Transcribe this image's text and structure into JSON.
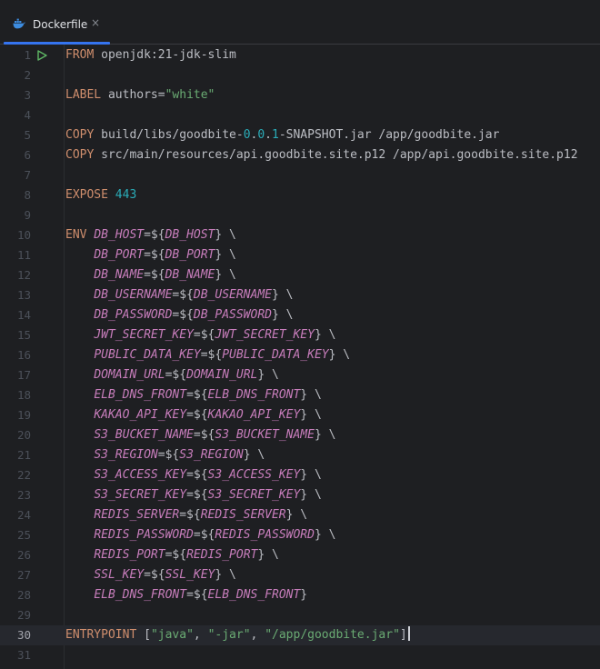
{
  "tab": {
    "label": "Dockerfile",
    "close": "×"
  },
  "colors": {
    "keyword": "#cf8e6d",
    "string": "#6aab73",
    "number": "#2aacb8",
    "variable": "#c77dbb",
    "text": "#bcbec4",
    "accent": "#3574f0"
  },
  "gutter": {
    "run_icon": "run-gutter-icon",
    "current_line": 30
  },
  "lines": [
    {
      "n": 1,
      "tokens": [
        {
          "t": "FROM",
          "c": "kw"
        },
        {
          "t": " openjdk:21-jdk-slim"
        }
      ]
    },
    {
      "n": 2,
      "tokens": []
    },
    {
      "n": 3,
      "tokens": [
        {
          "t": "LABEL",
          "c": "kw"
        },
        {
          "t": " authors="
        },
        {
          "t": "\"white\"",
          "c": "str"
        }
      ]
    },
    {
      "n": 4,
      "tokens": []
    },
    {
      "n": 5,
      "tokens": [
        {
          "t": "COPY",
          "c": "kw"
        },
        {
          "t": " build/libs/goodbite-"
        },
        {
          "t": "0",
          "c": "num"
        },
        {
          "t": "."
        },
        {
          "t": "0",
          "c": "num"
        },
        {
          "t": "."
        },
        {
          "t": "1",
          "c": "num"
        },
        {
          "t": "-SNAPSHOT.jar /app/goodbite.jar"
        }
      ]
    },
    {
      "n": 6,
      "tokens": [
        {
          "t": "COPY",
          "c": "kw"
        },
        {
          "t": " src/main/resources/api.goodbite.site.p12 /app/api.goodbite.site.p12"
        }
      ]
    },
    {
      "n": 7,
      "tokens": []
    },
    {
      "n": 8,
      "tokens": [
        {
          "t": "EXPOSE",
          "c": "kw"
        },
        {
          "t": " "
        },
        {
          "t": "443",
          "c": "num"
        }
      ]
    },
    {
      "n": 9,
      "tokens": []
    },
    {
      "n": 10,
      "tokens": [
        {
          "t": "ENV",
          "c": "kw"
        },
        {
          "t": " "
        },
        {
          "t": "DB_HOST",
          "c": "var"
        },
        {
          "t": "=${"
        },
        {
          "t": "DB_HOST",
          "c": "var"
        },
        {
          "t": "} \\"
        }
      ]
    },
    {
      "n": 11,
      "tokens": [
        {
          "t": "    "
        },
        {
          "t": "DB_PORT",
          "c": "var"
        },
        {
          "t": "=${"
        },
        {
          "t": "DB_PORT",
          "c": "var"
        },
        {
          "t": "} \\"
        }
      ]
    },
    {
      "n": 12,
      "tokens": [
        {
          "t": "    "
        },
        {
          "t": "DB_NAME",
          "c": "var"
        },
        {
          "t": "=${"
        },
        {
          "t": "DB_NAME",
          "c": "var"
        },
        {
          "t": "} \\"
        }
      ]
    },
    {
      "n": 13,
      "tokens": [
        {
          "t": "    "
        },
        {
          "t": "DB_USERNAME",
          "c": "var"
        },
        {
          "t": "=${"
        },
        {
          "t": "DB_USERNAME",
          "c": "var"
        },
        {
          "t": "} \\"
        }
      ]
    },
    {
      "n": 14,
      "tokens": [
        {
          "t": "    "
        },
        {
          "t": "DB_PASSWORD",
          "c": "var"
        },
        {
          "t": "=${"
        },
        {
          "t": "DB_PASSWORD",
          "c": "var"
        },
        {
          "t": "} \\"
        }
      ]
    },
    {
      "n": 15,
      "tokens": [
        {
          "t": "    "
        },
        {
          "t": "JWT_SECRET_KEY",
          "c": "var"
        },
        {
          "t": "=${"
        },
        {
          "t": "JWT_SECRET_KEY",
          "c": "var"
        },
        {
          "t": "} \\"
        }
      ]
    },
    {
      "n": 16,
      "tokens": [
        {
          "t": "    "
        },
        {
          "t": "PUBLIC_DATA_KEY",
          "c": "var"
        },
        {
          "t": "=${"
        },
        {
          "t": "PUBLIC_DATA_KEY",
          "c": "var"
        },
        {
          "t": "} \\"
        }
      ]
    },
    {
      "n": 17,
      "tokens": [
        {
          "t": "    "
        },
        {
          "t": "DOMAIN_URL",
          "c": "var"
        },
        {
          "t": "=${"
        },
        {
          "t": "DOMAIN_URL",
          "c": "var"
        },
        {
          "t": "} \\"
        }
      ]
    },
    {
      "n": 18,
      "tokens": [
        {
          "t": "    "
        },
        {
          "t": "ELB_DNS_FRONT",
          "c": "var"
        },
        {
          "t": "=${"
        },
        {
          "t": "ELB_DNS_FRONT",
          "c": "var"
        },
        {
          "t": "} \\"
        }
      ]
    },
    {
      "n": 19,
      "tokens": [
        {
          "t": "    "
        },
        {
          "t": "KAKAO_API_KEY",
          "c": "var"
        },
        {
          "t": "=${"
        },
        {
          "t": "KAKAO_API_KEY",
          "c": "var"
        },
        {
          "t": "} \\"
        }
      ]
    },
    {
      "n": 20,
      "tokens": [
        {
          "t": "    "
        },
        {
          "t": "S3_BUCKET_NAME",
          "c": "var"
        },
        {
          "t": "=${"
        },
        {
          "t": "S3_BUCKET_NAME",
          "c": "var"
        },
        {
          "t": "} \\"
        }
      ]
    },
    {
      "n": 21,
      "tokens": [
        {
          "t": "    "
        },
        {
          "t": "S3_REGION",
          "c": "var"
        },
        {
          "t": "=${"
        },
        {
          "t": "S3_REGION",
          "c": "var"
        },
        {
          "t": "} \\"
        }
      ]
    },
    {
      "n": 22,
      "tokens": [
        {
          "t": "    "
        },
        {
          "t": "S3_ACCESS_KEY",
          "c": "var"
        },
        {
          "t": "=${"
        },
        {
          "t": "S3_ACCESS_KEY",
          "c": "var"
        },
        {
          "t": "} \\"
        }
      ]
    },
    {
      "n": 23,
      "tokens": [
        {
          "t": "    "
        },
        {
          "t": "S3_SECRET_KEY",
          "c": "var"
        },
        {
          "t": "=${"
        },
        {
          "t": "S3_SECRET_KEY",
          "c": "var"
        },
        {
          "t": "} \\"
        }
      ]
    },
    {
      "n": 24,
      "tokens": [
        {
          "t": "    "
        },
        {
          "t": "REDIS_SERVER",
          "c": "var"
        },
        {
          "t": "=${"
        },
        {
          "t": "REDIS_SERVER",
          "c": "var"
        },
        {
          "t": "} \\"
        }
      ]
    },
    {
      "n": 25,
      "tokens": [
        {
          "t": "    "
        },
        {
          "t": "REDIS_PASSWORD",
          "c": "var"
        },
        {
          "t": "=${"
        },
        {
          "t": "REDIS_PASSWORD",
          "c": "var"
        },
        {
          "t": "} \\"
        }
      ]
    },
    {
      "n": 26,
      "tokens": [
        {
          "t": "    "
        },
        {
          "t": "REDIS_PORT",
          "c": "var"
        },
        {
          "t": "=${"
        },
        {
          "t": "REDIS_PORT",
          "c": "var"
        },
        {
          "t": "} \\"
        }
      ]
    },
    {
      "n": 27,
      "tokens": [
        {
          "t": "    "
        },
        {
          "t": "SSL_KEY",
          "c": "var"
        },
        {
          "t": "=${"
        },
        {
          "t": "SSL_KEY",
          "c": "var"
        },
        {
          "t": "} \\"
        }
      ]
    },
    {
      "n": 28,
      "tokens": [
        {
          "t": "    "
        },
        {
          "t": "ELB_DNS_FRONT",
          "c": "var"
        },
        {
          "t": "=${"
        },
        {
          "t": "ELB_DNS_FRONT",
          "c": "var"
        },
        {
          "t": "}"
        }
      ]
    },
    {
      "n": 29,
      "tokens": []
    },
    {
      "n": 30,
      "tokens": [
        {
          "t": "ENTRYPOINT",
          "c": "kw"
        },
        {
          "t": " ["
        },
        {
          "t": "\"java\"",
          "c": "str"
        },
        {
          "t": ", "
        },
        {
          "t": "\"-jar\"",
          "c": "str"
        },
        {
          "t": ", "
        },
        {
          "t": "\"/app/goodbite.jar\"",
          "c": "str"
        },
        {
          "t": "]"
        }
      ]
    },
    {
      "n": 31,
      "tokens": []
    }
  ]
}
